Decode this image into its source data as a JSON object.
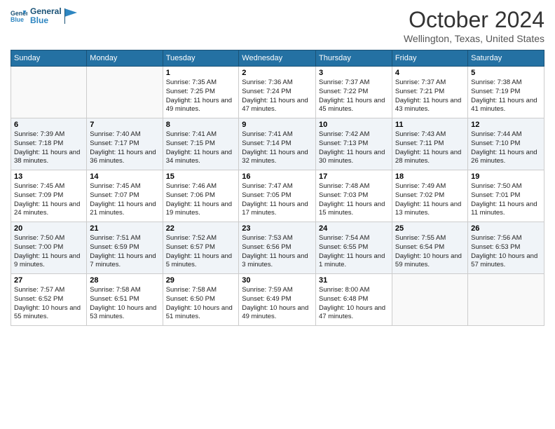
{
  "logo": {
    "general": "General",
    "blue": "Blue"
  },
  "header": {
    "title": "October 2024",
    "location": "Wellington, Texas, United States"
  },
  "columns": [
    "Sunday",
    "Monday",
    "Tuesday",
    "Wednesday",
    "Thursday",
    "Friday",
    "Saturday"
  ],
  "weeks": [
    [
      {
        "day": "",
        "sunrise": "",
        "sunset": "",
        "daylight": ""
      },
      {
        "day": "",
        "sunrise": "",
        "sunset": "",
        "daylight": ""
      },
      {
        "day": "1",
        "sunrise": "Sunrise: 7:35 AM",
        "sunset": "Sunset: 7:25 PM",
        "daylight": "Daylight: 11 hours and 49 minutes."
      },
      {
        "day": "2",
        "sunrise": "Sunrise: 7:36 AM",
        "sunset": "Sunset: 7:24 PM",
        "daylight": "Daylight: 11 hours and 47 minutes."
      },
      {
        "day": "3",
        "sunrise": "Sunrise: 7:37 AM",
        "sunset": "Sunset: 7:22 PM",
        "daylight": "Daylight: 11 hours and 45 minutes."
      },
      {
        "day": "4",
        "sunrise": "Sunrise: 7:37 AM",
        "sunset": "Sunset: 7:21 PM",
        "daylight": "Daylight: 11 hours and 43 minutes."
      },
      {
        "day": "5",
        "sunrise": "Sunrise: 7:38 AM",
        "sunset": "Sunset: 7:19 PM",
        "daylight": "Daylight: 11 hours and 41 minutes."
      }
    ],
    [
      {
        "day": "6",
        "sunrise": "Sunrise: 7:39 AM",
        "sunset": "Sunset: 7:18 PM",
        "daylight": "Daylight: 11 hours and 38 minutes."
      },
      {
        "day": "7",
        "sunrise": "Sunrise: 7:40 AM",
        "sunset": "Sunset: 7:17 PM",
        "daylight": "Daylight: 11 hours and 36 minutes."
      },
      {
        "day": "8",
        "sunrise": "Sunrise: 7:41 AM",
        "sunset": "Sunset: 7:15 PM",
        "daylight": "Daylight: 11 hours and 34 minutes."
      },
      {
        "day": "9",
        "sunrise": "Sunrise: 7:41 AM",
        "sunset": "Sunset: 7:14 PM",
        "daylight": "Daylight: 11 hours and 32 minutes."
      },
      {
        "day": "10",
        "sunrise": "Sunrise: 7:42 AM",
        "sunset": "Sunset: 7:13 PM",
        "daylight": "Daylight: 11 hours and 30 minutes."
      },
      {
        "day": "11",
        "sunrise": "Sunrise: 7:43 AM",
        "sunset": "Sunset: 7:11 PM",
        "daylight": "Daylight: 11 hours and 28 minutes."
      },
      {
        "day": "12",
        "sunrise": "Sunrise: 7:44 AM",
        "sunset": "Sunset: 7:10 PM",
        "daylight": "Daylight: 11 hours and 26 minutes."
      }
    ],
    [
      {
        "day": "13",
        "sunrise": "Sunrise: 7:45 AM",
        "sunset": "Sunset: 7:09 PM",
        "daylight": "Daylight: 11 hours and 24 minutes."
      },
      {
        "day": "14",
        "sunrise": "Sunrise: 7:45 AM",
        "sunset": "Sunset: 7:07 PM",
        "daylight": "Daylight: 11 hours and 21 minutes."
      },
      {
        "day": "15",
        "sunrise": "Sunrise: 7:46 AM",
        "sunset": "Sunset: 7:06 PM",
        "daylight": "Daylight: 11 hours and 19 minutes."
      },
      {
        "day": "16",
        "sunrise": "Sunrise: 7:47 AM",
        "sunset": "Sunset: 7:05 PM",
        "daylight": "Daylight: 11 hours and 17 minutes."
      },
      {
        "day": "17",
        "sunrise": "Sunrise: 7:48 AM",
        "sunset": "Sunset: 7:03 PM",
        "daylight": "Daylight: 11 hours and 15 minutes."
      },
      {
        "day": "18",
        "sunrise": "Sunrise: 7:49 AM",
        "sunset": "Sunset: 7:02 PM",
        "daylight": "Daylight: 11 hours and 13 minutes."
      },
      {
        "day": "19",
        "sunrise": "Sunrise: 7:50 AM",
        "sunset": "Sunset: 7:01 PM",
        "daylight": "Daylight: 11 hours and 11 minutes."
      }
    ],
    [
      {
        "day": "20",
        "sunrise": "Sunrise: 7:50 AM",
        "sunset": "Sunset: 7:00 PM",
        "daylight": "Daylight: 11 hours and 9 minutes."
      },
      {
        "day": "21",
        "sunrise": "Sunrise: 7:51 AM",
        "sunset": "Sunset: 6:59 PM",
        "daylight": "Daylight: 11 hours and 7 minutes."
      },
      {
        "day": "22",
        "sunrise": "Sunrise: 7:52 AM",
        "sunset": "Sunset: 6:57 PM",
        "daylight": "Daylight: 11 hours and 5 minutes."
      },
      {
        "day": "23",
        "sunrise": "Sunrise: 7:53 AM",
        "sunset": "Sunset: 6:56 PM",
        "daylight": "Daylight: 11 hours and 3 minutes."
      },
      {
        "day": "24",
        "sunrise": "Sunrise: 7:54 AM",
        "sunset": "Sunset: 6:55 PM",
        "daylight": "Daylight: 11 hours and 1 minute."
      },
      {
        "day": "25",
        "sunrise": "Sunrise: 7:55 AM",
        "sunset": "Sunset: 6:54 PM",
        "daylight": "Daylight: 10 hours and 59 minutes."
      },
      {
        "day": "26",
        "sunrise": "Sunrise: 7:56 AM",
        "sunset": "Sunset: 6:53 PM",
        "daylight": "Daylight: 10 hours and 57 minutes."
      }
    ],
    [
      {
        "day": "27",
        "sunrise": "Sunrise: 7:57 AM",
        "sunset": "Sunset: 6:52 PM",
        "daylight": "Daylight: 10 hours and 55 minutes."
      },
      {
        "day": "28",
        "sunrise": "Sunrise: 7:58 AM",
        "sunset": "Sunset: 6:51 PM",
        "daylight": "Daylight: 10 hours and 53 minutes."
      },
      {
        "day": "29",
        "sunrise": "Sunrise: 7:58 AM",
        "sunset": "Sunset: 6:50 PM",
        "daylight": "Daylight: 10 hours and 51 minutes."
      },
      {
        "day": "30",
        "sunrise": "Sunrise: 7:59 AM",
        "sunset": "Sunset: 6:49 PM",
        "daylight": "Daylight: 10 hours and 49 minutes."
      },
      {
        "day": "31",
        "sunrise": "Sunrise: 8:00 AM",
        "sunset": "Sunset: 6:48 PM",
        "daylight": "Daylight: 10 hours and 47 minutes."
      },
      {
        "day": "",
        "sunrise": "",
        "sunset": "",
        "daylight": ""
      },
      {
        "day": "",
        "sunrise": "",
        "sunset": "",
        "daylight": ""
      }
    ]
  ]
}
